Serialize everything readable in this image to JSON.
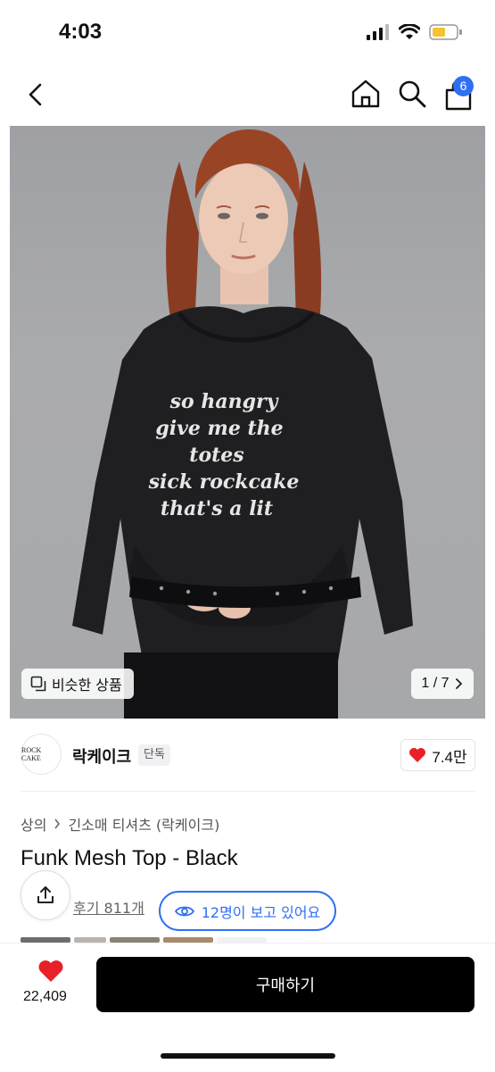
{
  "status": {
    "time": "4:03"
  },
  "nav": {
    "cart_count": "6"
  },
  "gallery": {
    "similar_label": "비슷한 상품",
    "pager": "1 / 7",
    "shirt_text": [
      "so hangry",
      "give me the",
      "totes",
      "sick rockcake",
      "that's a lit"
    ]
  },
  "brand": {
    "logo_text": "ROCK CAKE",
    "name": "락케이크",
    "tag": "단독",
    "likes": "7.4만"
  },
  "breadcrumb": [
    "상의",
    "긴소매 티셔츠 (락케이크)"
  ],
  "product": {
    "title": "Funk Mesh Top - Black",
    "review_link": "후기 811개",
    "viewers": "12명이 보고 있어요"
  },
  "bottom_bar": {
    "wish_count": "22,409",
    "buy_label": "구매하기"
  },
  "colors": {
    "accent": "#2f6ff3",
    "heart": "#e8202a",
    "buy_bg": "#000000"
  }
}
